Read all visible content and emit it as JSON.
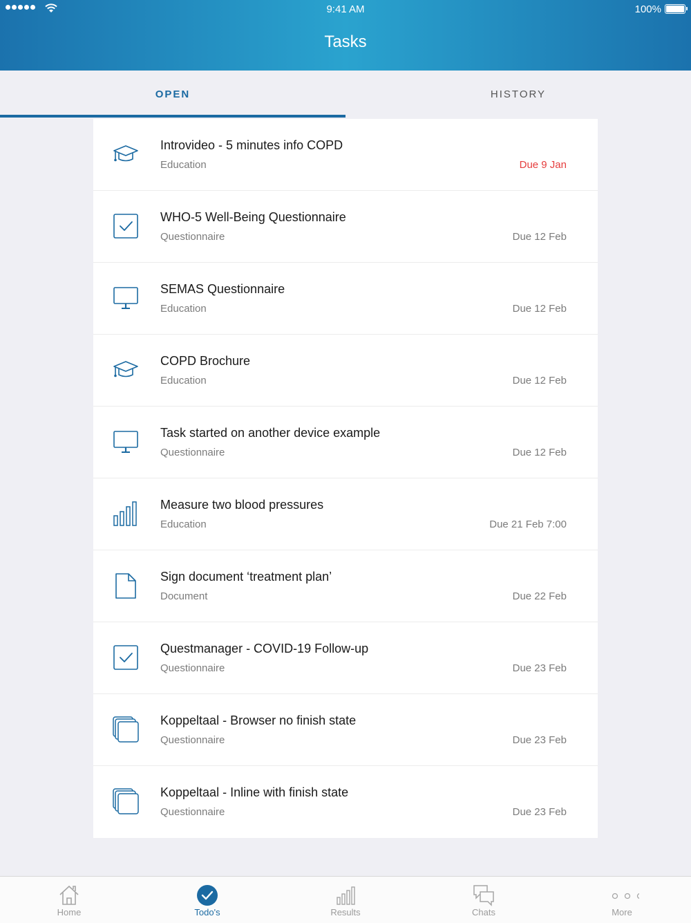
{
  "status": {
    "time": "9:41 AM",
    "battery": "100%"
  },
  "header": {
    "title": "Tasks"
  },
  "tabs": {
    "open": "OPEN",
    "history": "HISTORY"
  },
  "tasks": [
    {
      "name": "Introvideo - 5 minutes info COPD",
      "category": "Education",
      "due": "Due 9 Jan",
      "overdue": true,
      "icon": "graduation-cap-icon"
    },
    {
      "name": "WHO-5 Well-Being Questionnaire",
      "category": "Questionnaire",
      "due": "Due 12 Feb",
      "overdue": false,
      "icon": "checkbox-icon"
    },
    {
      "name": "SEMAS Questionnaire",
      "category": "Education",
      "due": "Due 12 Feb",
      "overdue": false,
      "icon": "monitor-icon"
    },
    {
      "name": "COPD Brochure",
      "category": "Education",
      "due": "Due 12 Feb",
      "overdue": false,
      "icon": "graduation-cap-icon"
    },
    {
      "name": "Task started on another device example",
      "category": "Questionnaire",
      "due": "Due 12 Feb",
      "overdue": false,
      "icon": "monitor-icon"
    },
    {
      "name": "Measure two blood pressures",
      "category": "Education",
      "due": "Due 21 Feb 7:00",
      "overdue": false,
      "icon": "bar-chart-icon"
    },
    {
      "name": "Sign document ‘treatment plan’",
      "category": "Document",
      "due": "Due 22 Feb",
      "overdue": false,
      "icon": "document-icon"
    },
    {
      "name": "Questmanager - COVID-19 Follow-up",
      "category": "Questionnaire",
      "due": "Due 23 Feb",
      "overdue": false,
      "icon": "checkbox-icon"
    },
    {
      "name": "Koppeltaal - Browser no finish state",
      "category": "Questionnaire",
      "due": "Due 23 Feb",
      "overdue": false,
      "icon": "stacked-windows-icon"
    },
    {
      "name": "Koppeltaal - Inline with finish state",
      "category": "Questionnaire",
      "due": "Due 23 Feb",
      "overdue": false,
      "icon": "stacked-windows-icon"
    }
  ],
  "tabbar": {
    "home": "Home",
    "todos": "Todo's",
    "results": "Results",
    "chats": "Chats",
    "more": "More"
  },
  "colors": {
    "accent": "#1b6aa2",
    "overdue": "#e53d3d",
    "secondary_text": "#7b7b7b"
  }
}
